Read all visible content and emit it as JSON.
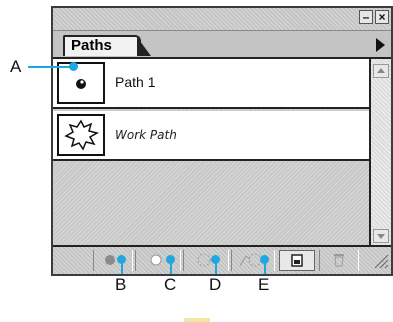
{
  "panel": {
    "tab_label": "Paths",
    "window_buttons": {
      "minimize_label": "–",
      "close_label": "×"
    },
    "paths": [
      {
        "label": "Path 1",
        "style": "normal",
        "thumbnail_icon": "filled-dot-icon"
      },
      {
        "label": "Work Path",
        "style": "italic",
        "thumbnail_icon": "starburst-outline-icon"
      }
    ],
    "bottom_buttons": [
      {
        "name": "fill-path-button",
        "icon": "filled-circle-icon"
      },
      {
        "name": "stroke-path-button",
        "icon": "outline-circle-icon"
      },
      {
        "name": "load-as-selection-button",
        "icon": "dashed-circle-icon"
      },
      {
        "name": "make-work-path-button",
        "icon": "selection-to-path-icon"
      },
      {
        "name": "new-path-button",
        "icon": "new-page-icon"
      },
      {
        "name": "delete-path-button",
        "icon": "trash-icon"
      }
    ]
  },
  "callouts": {
    "a": "A",
    "b": "B",
    "c": "C",
    "d": "D",
    "e": "E"
  },
  "colors": {
    "callout_accent": "#1ea7e0",
    "panel_bg": "#c8c8c8"
  }
}
